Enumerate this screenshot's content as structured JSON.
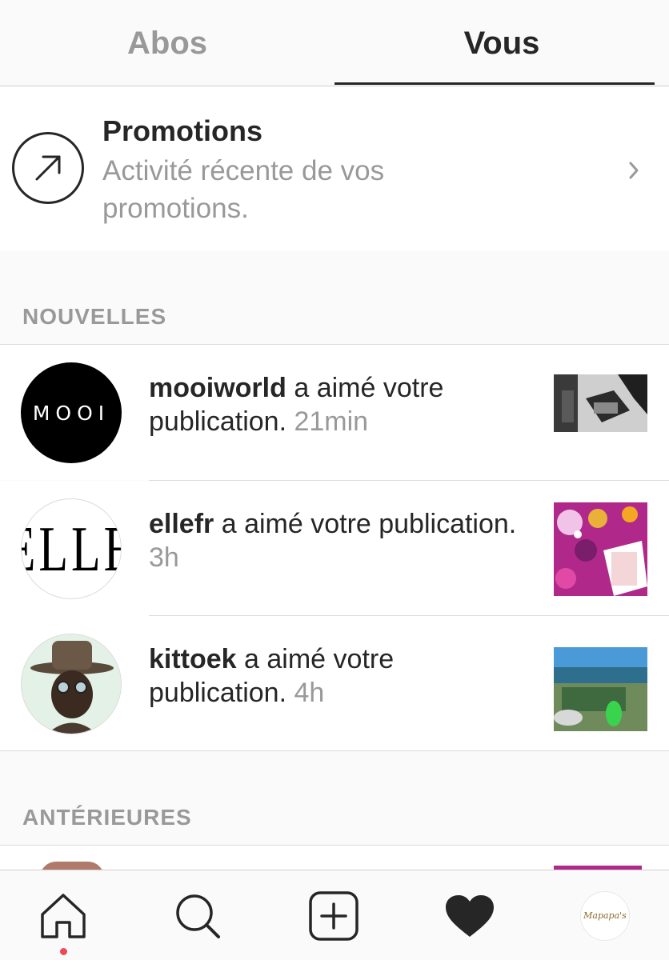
{
  "tabs": [
    {
      "label": "Abos",
      "active": false
    },
    {
      "label": "Vous",
      "active": true
    }
  ],
  "promotions": {
    "title": "Promotions",
    "subtitle": "Activité récente de vos promotions.",
    "icon": "arrow-up-right-icon"
  },
  "sections": {
    "new": "NOUVELLES",
    "older": "ANTÉRIEURES"
  },
  "notifications": [
    {
      "user": "mooiworld",
      "action": " a aimé votre publication.",
      "time": "21min",
      "avatar_text": "MOOI"
    },
    {
      "user": "ellefr",
      "action": " a aimé votre publication.",
      "time": "3h",
      "avatar_text": "ELLE"
    },
    {
      "user": "kittoek",
      "action": " a aimé votre publication.",
      "time": "4h"
    }
  ],
  "bottom_nav": {
    "items": [
      "home-icon",
      "search-icon",
      "add-post-icon",
      "heart-icon",
      "profile-avatar"
    ],
    "profile_label": "Mapapa's",
    "active": "heart-icon",
    "notification_dot_color": "#ed4956"
  },
  "colors": {
    "text": "#262626",
    "secondary": "#999999",
    "separator": "#dbdbdb",
    "background": "#fafafa"
  }
}
